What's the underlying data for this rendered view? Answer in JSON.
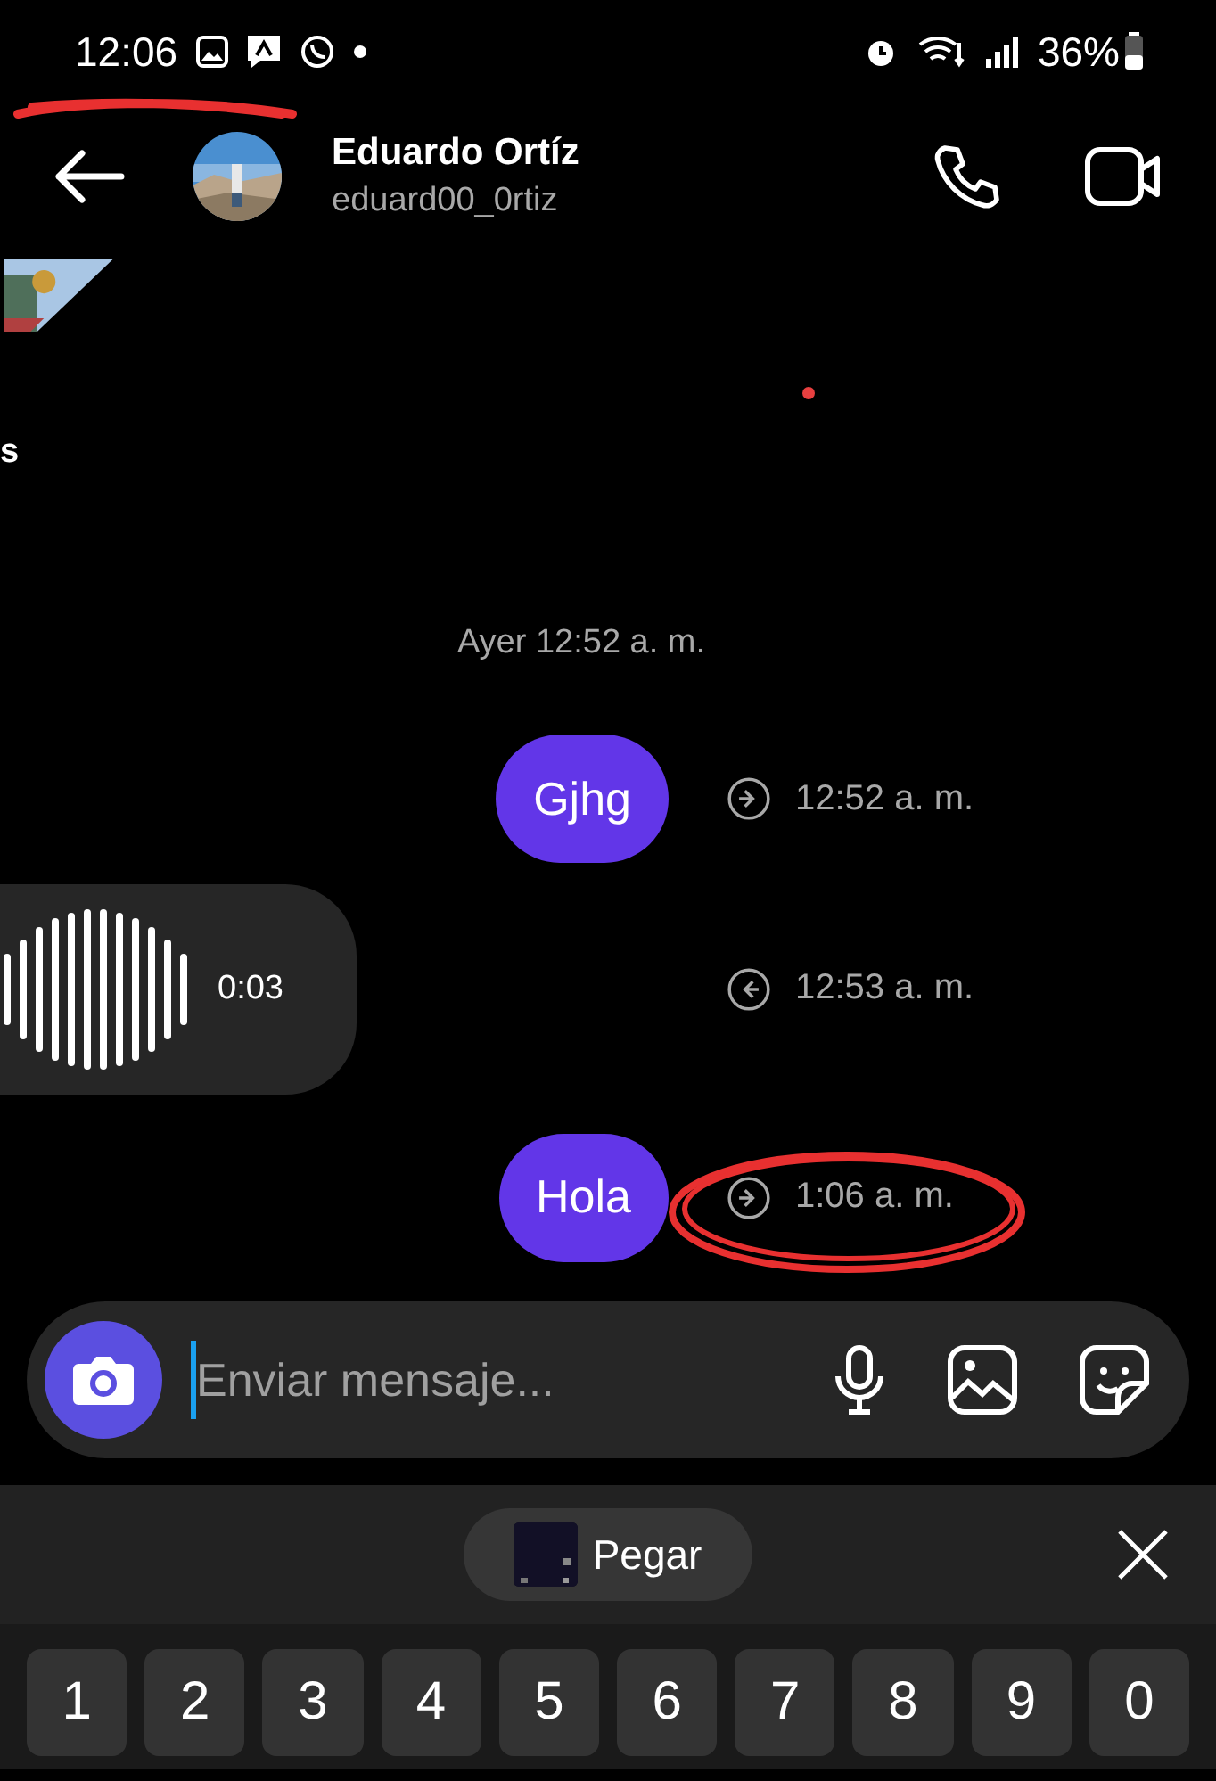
{
  "status_bar": {
    "time": "12:06",
    "battery": "36%"
  },
  "header": {
    "name": "Eduardo Ortíz",
    "username": "eduard00_0rtiz"
  },
  "cut_text": "s",
  "date_divider": "Ayer 12:52 a. m.",
  "messages": [
    {
      "kind": "text",
      "outgoing": true,
      "text": "Gjhg",
      "time": "12:52 a. m."
    },
    {
      "kind": "voice",
      "outgoing": false,
      "duration": "0:03",
      "time": "12:53 a. m."
    },
    {
      "kind": "text",
      "outgoing": true,
      "text": "Hola",
      "time": "1:06 a. m."
    }
  ],
  "composer": {
    "placeholder": "Enviar mensaje..."
  },
  "clipboard": {
    "label": "Pegar"
  },
  "keys": [
    "1",
    "2",
    "3",
    "4",
    "5",
    "6",
    "7",
    "8",
    "9",
    "0"
  ]
}
